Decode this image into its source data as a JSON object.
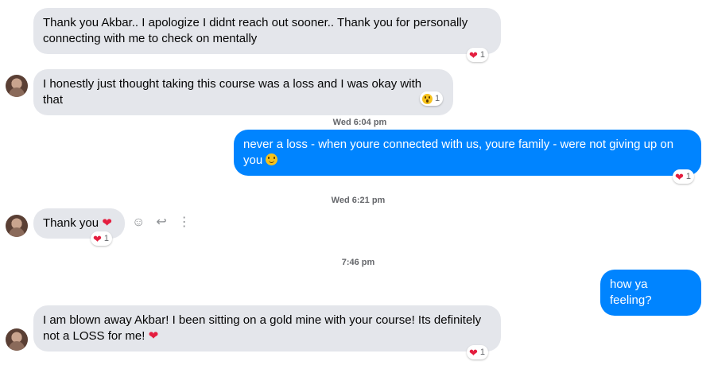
{
  "messages": [
    {
      "text": "Thank you Akbar.. I apologize I didnt reach out sooner.. Thank you for personally connecting with me to check on mentally",
      "reaction": {
        "emoji": "heart",
        "count": "1"
      }
    },
    {
      "text": "I honestly just thought taking this course was a loss and I was okay with that",
      "reaction": {
        "emoji": "wow",
        "count": "1"
      }
    },
    {
      "timestamp": "Wed 6:04 pm"
    },
    {
      "text": "never a loss - when youre connected with us, youre family - were not giving up on you",
      "reaction": {
        "emoji": "heart",
        "count": "1"
      }
    },
    {
      "timestamp": "Wed 6:21 pm"
    },
    {
      "text": "Thank you",
      "reaction": {
        "emoji": "heart",
        "count": "1"
      }
    },
    {
      "timestamp": "7:46 pm"
    },
    {
      "text": "how ya feeling?"
    },
    {
      "text": "I am blown away Akbar! I been sitting on a gold mine with your course! Its definitely not a LOSS for me!",
      "reaction": {
        "emoji": "heart",
        "count": "1"
      }
    }
  ],
  "icons": {
    "heart": "❤",
    "react": "☺",
    "reply": "↩",
    "more": "⋮"
  },
  "colors": {
    "outgoing": "#0084ff",
    "incoming": "#e4e6eb",
    "heart": "#e41e3f"
  }
}
